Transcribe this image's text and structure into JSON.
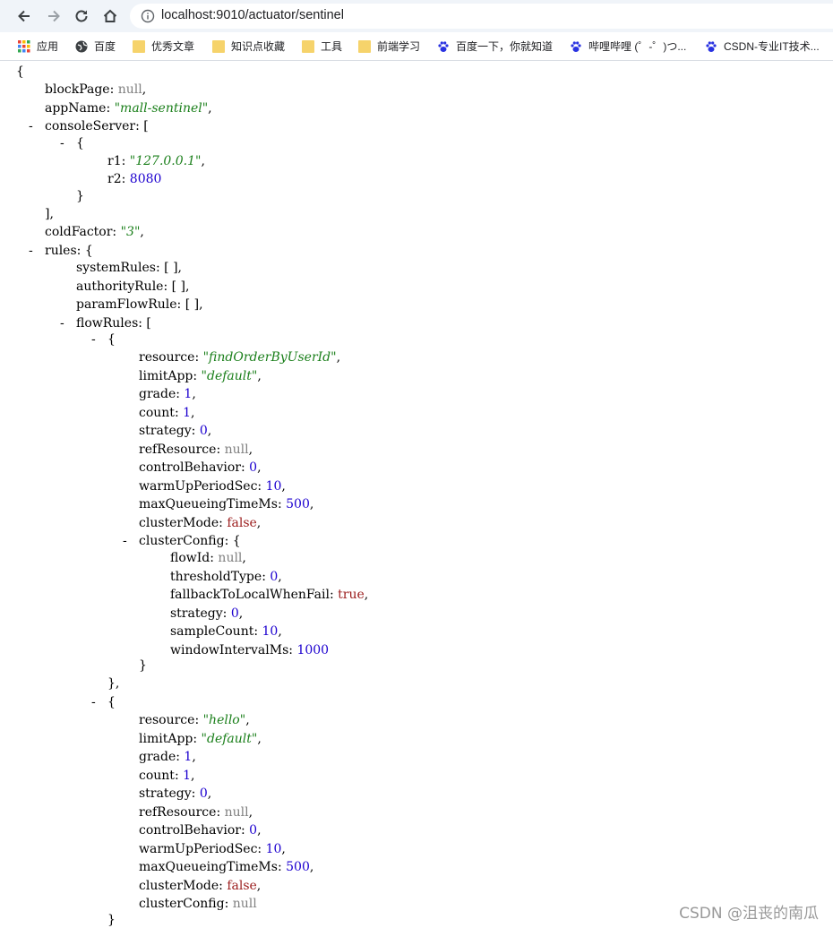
{
  "browser": {
    "url": "localhost:9010/actuator/sentinel",
    "bookmarks": [
      {
        "label": "应用",
        "icon": "apps-grid-icon"
      },
      {
        "label": "百度",
        "icon": "globe-icon"
      },
      {
        "label": "优秀文章",
        "icon": "folder-icon"
      },
      {
        "label": "知识点收藏",
        "icon": "folder-icon"
      },
      {
        "label": "工具",
        "icon": "folder-icon"
      },
      {
        "label": "前端学习",
        "icon": "folder-icon"
      },
      {
        "label": "百度一下，你就知道",
        "icon": "baidu-paw-icon"
      },
      {
        "label": "哔哩哔哩 (゜-゜)つ...",
        "icon": "baidu-paw-icon"
      },
      {
        "label": "CSDN-专业IT技术...",
        "icon": "baidu-paw-icon"
      }
    ]
  },
  "json_lines": [
    {
      "parts": [
        [
          "p",
          "{"
        ]
      ]
    },
    {
      "parts": [
        [
          "k",
          "blockPage"
        ],
        [
          "p",
          ": "
        ],
        [
          "n",
          "null"
        ],
        [
          "p",
          ","
        ]
      ]
    },
    {
      "parts": [
        [
          "k",
          "appName"
        ],
        [
          "p",
          ": "
        ],
        [
          "s",
          "\"mall-sentinel\""
        ],
        [
          "p",
          ","
        ]
      ]
    },
    {
      "toggle": "-",
      "parts": [
        [
          "k",
          "consoleServer"
        ],
        [
          "p",
          ": ["
        ]
      ]
    },
    {
      "toggle": "-",
      "parts": [
        [
          "p",
          "{"
        ]
      ]
    },
    {
      "parts": [
        [
          "k",
          "r1"
        ],
        [
          "p",
          ": "
        ],
        [
          "s",
          "\"127.0.0.1\""
        ],
        [
          "p",
          ","
        ]
      ]
    },
    {
      "parts": [
        [
          "k",
          "r2"
        ],
        [
          "p",
          ": "
        ],
        [
          "u",
          "8080"
        ]
      ]
    },
    {
      "parts": [
        [
          "p",
          "}"
        ]
      ]
    },
    {
      "parts": [
        [
          "p",
          "],"
        ]
      ]
    },
    {
      "parts": [
        [
          "k",
          "coldFactor"
        ],
        [
          "p",
          ": "
        ],
        [
          "s",
          "\"3\""
        ],
        [
          "p",
          ","
        ]
      ]
    },
    {
      "toggle": "-",
      "parts": [
        [
          "k",
          "rules"
        ],
        [
          "p",
          ": {"
        ]
      ]
    },
    {
      "parts": [
        [
          "k",
          "systemRules"
        ],
        [
          "p",
          ": [ ],"
        ]
      ]
    },
    {
      "parts": [
        [
          "k",
          "authorityRule"
        ],
        [
          "p",
          ": [ ],"
        ]
      ]
    },
    {
      "parts": [
        [
          "k",
          "paramFlowRule"
        ],
        [
          "p",
          ": [ ],"
        ]
      ]
    },
    {
      "toggle": "-",
      "parts": [
        [
          "k",
          "flowRules"
        ],
        [
          "p",
          ": ["
        ]
      ]
    },
    {
      "toggle": "-",
      "parts": [
        [
          "p",
          "{"
        ]
      ]
    },
    {
      "parts": [
        [
          "k",
          "resource"
        ],
        [
          "p",
          ": "
        ],
        [
          "s",
          "\"findOrderByUserId\""
        ],
        [
          "p",
          ","
        ]
      ]
    },
    {
      "parts": [
        [
          "k",
          "limitApp"
        ],
        [
          "p",
          ": "
        ],
        [
          "s",
          "\"default\""
        ],
        [
          "p",
          ","
        ]
      ]
    },
    {
      "parts": [
        [
          "k",
          "grade"
        ],
        [
          "p",
          ": "
        ],
        [
          "u",
          "1"
        ],
        [
          "p",
          ","
        ]
      ]
    },
    {
      "parts": [
        [
          "k",
          "count"
        ],
        [
          "p",
          ": "
        ],
        [
          "u",
          "1"
        ],
        [
          "p",
          ","
        ]
      ]
    },
    {
      "parts": [
        [
          "k",
          "strategy"
        ],
        [
          "p",
          ": "
        ],
        [
          "u",
          "0"
        ],
        [
          "p",
          ","
        ]
      ]
    },
    {
      "parts": [
        [
          "k",
          "refResource"
        ],
        [
          "p",
          ": "
        ],
        [
          "n",
          "null"
        ],
        [
          "p",
          ","
        ]
      ]
    },
    {
      "parts": [
        [
          "k",
          "controlBehavior"
        ],
        [
          "p",
          ": "
        ],
        [
          "u",
          "0"
        ],
        [
          "p",
          ","
        ]
      ]
    },
    {
      "parts": [
        [
          "k",
          "warmUpPeriodSec"
        ],
        [
          "p",
          ": "
        ],
        [
          "u",
          "10"
        ],
        [
          "p",
          ","
        ]
      ]
    },
    {
      "parts": [
        [
          "k",
          "maxQueueingTimeMs"
        ],
        [
          "p",
          ": "
        ],
        [
          "u",
          "500"
        ],
        [
          "p",
          ","
        ]
      ]
    },
    {
      "parts": [
        [
          "k",
          "clusterMode"
        ],
        [
          "p",
          ": "
        ],
        [
          "b",
          "false"
        ],
        [
          "p",
          ","
        ]
      ]
    },
    {
      "toggle": "-",
      "parts": [
        [
          "k",
          "clusterConfig"
        ],
        [
          "p",
          ": {"
        ]
      ]
    },
    {
      "parts": [
        [
          "k",
          "flowId"
        ],
        [
          "p",
          ": "
        ],
        [
          "n",
          "null"
        ],
        [
          "p",
          ","
        ]
      ]
    },
    {
      "parts": [
        [
          "k",
          "thresholdType"
        ],
        [
          "p",
          ": "
        ],
        [
          "u",
          "0"
        ],
        [
          "p",
          ","
        ]
      ]
    },
    {
      "parts": [
        [
          "k",
          "fallbackToLocalWhenFail"
        ],
        [
          "p",
          ": "
        ],
        [
          "b",
          "true"
        ],
        [
          "p",
          ","
        ]
      ]
    },
    {
      "parts": [
        [
          "k",
          "strategy"
        ],
        [
          "p",
          ": "
        ],
        [
          "u",
          "0"
        ],
        [
          "p",
          ","
        ]
      ]
    },
    {
      "parts": [
        [
          "k",
          "sampleCount"
        ],
        [
          "p",
          ": "
        ],
        [
          "u",
          "10"
        ],
        [
          "p",
          ","
        ]
      ]
    },
    {
      "parts": [
        [
          "k",
          "windowIntervalMs"
        ],
        [
          "p",
          ": "
        ],
        [
          "u",
          "1000"
        ]
      ]
    },
    {
      "parts": [
        [
          "p",
          "}"
        ]
      ]
    },
    {
      "parts": [
        [
          "p",
          "},"
        ]
      ]
    },
    {
      "toggle": "-",
      "parts": [
        [
          "p",
          "{"
        ]
      ]
    },
    {
      "parts": [
        [
          "k",
          "resource"
        ],
        [
          "p",
          ": "
        ],
        [
          "s",
          "\"hello\""
        ],
        [
          "p",
          ","
        ]
      ]
    },
    {
      "parts": [
        [
          "k",
          "limitApp"
        ],
        [
          "p",
          ": "
        ],
        [
          "s",
          "\"default\""
        ],
        [
          "p",
          ","
        ]
      ]
    },
    {
      "parts": [
        [
          "k",
          "grade"
        ],
        [
          "p",
          ": "
        ],
        [
          "u",
          "1"
        ],
        [
          "p",
          ","
        ]
      ]
    },
    {
      "parts": [
        [
          "k",
          "count"
        ],
        [
          "p",
          ": "
        ],
        [
          "u",
          "1"
        ],
        [
          "p",
          ","
        ]
      ]
    },
    {
      "parts": [
        [
          "k",
          "strategy"
        ],
        [
          "p",
          ": "
        ],
        [
          "u",
          "0"
        ],
        [
          "p",
          ","
        ]
      ]
    },
    {
      "parts": [
        [
          "k",
          "refResource"
        ],
        [
          "p",
          ": "
        ],
        [
          "n",
          "null"
        ],
        [
          "p",
          ","
        ]
      ]
    },
    {
      "parts": [
        [
          "k",
          "controlBehavior"
        ],
        [
          "p",
          ": "
        ],
        [
          "u",
          "0"
        ],
        [
          "p",
          ","
        ]
      ]
    },
    {
      "parts": [
        [
          "k",
          "warmUpPeriodSec"
        ],
        [
          "p",
          ": "
        ],
        [
          "u",
          "10"
        ],
        [
          "p",
          ","
        ]
      ]
    },
    {
      "parts": [
        [
          "k",
          "maxQueueingTimeMs"
        ],
        [
          "p",
          ": "
        ],
        [
          "u",
          "500"
        ],
        [
          "p",
          ","
        ]
      ]
    },
    {
      "parts": [
        [
          "k",
          "clusterMode"
        ],
        [
          "p",
          ": "
        ],
        [
          "b",
          "false"
        ],
        [
          "p",
          ","
        ]
      ]
    },
    {
      "parts": [
        [
          "k",
          "clusterConfig"
        ],
        [
          "p",
          ": "
        ],
        [
          "n",
          "null"
        ]
      ]
    },
    {
      "parts": [
        [
          "p",
          "}"
        ]
      ]
    }
  ],
  "watermark": "CSDN @沮丧的南瓜"
}
